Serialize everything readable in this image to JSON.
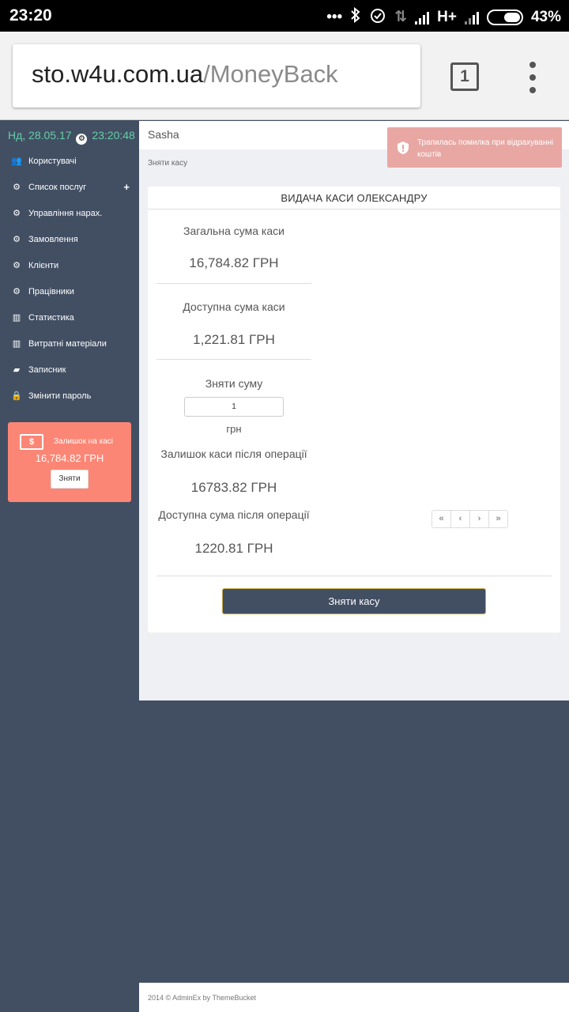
{
  "status_bar": {
    "time": "23:20",
    "network": "H+",
    "battery": "43%",
    "icons": [
      "dots-icon",
      "bluetooth-icon",
      "alarm-icon",
      "data-transfer-icon",
      "signal-icon",
      "battery-icon"
    ]
  },
  "browser": {
    "url_host": "sto.w4u.com.ua",
    "url_path": "/MoneyBack",
    "tab_count": "1"
  },
  "sidebar": {
    "date": "Нд, 28.05.17",
    "time": "23:20:48",
    "items": [
      {
        "label": "Користувачі",
        "icon": "users-icon"
      },
      {
        "label": "Список послуг",
        "icon": "cogs-icon"
      },
      {
        "label": "Управління нарах.",
        "icon": "cogs-icon"
      },
      {
        "label": "Замовлення",
        "icon": "cogs-icon"
      },
      {
        "label": "Клієнти",
        "icon": "cogs-icon"
      },
      {
        "label": "Працівники",
        "icon": "cogs-icon"
      },
      {
        "label": "Статистика",
        "icon": "bar-chart-icon"
      },
      {
        "label": "Витратні матеріали",
        "icon": "bar-chart-icon"
      },
      {
        "label": "Записник",
        "icon": "book-icon"
      },
      {
        "label": "Змінити пароль",
        "icon": "lock-icon"
      }
    ],
    "balance": {
      "label": "Залишок на касі",
      "amount": "16,784.82 ГРН",
      "button": "Зняти"
    }
  },
  "header": {
    "user": "Sasha"
  },
  "alert": {
    "text": "Трапилась помилка при відрахуванні коштів"
  },
  "breadcrumb": "Зняти касу",
  "panel": {
    "title": "ВИДАЧА КАСИ ОЛЕКСАНДРУ",
    "total_label": "Загальна сума каси",
    "total_value": "16,784.82 ГРН",
    "available_label": "Доступна сума каси",
    "available_value": "1,221.81 ГРН",
    "withdraw_label": "Зняти суму",
    "withdraw_value": "1",
    "currency": "грн",
    "remaining_label": "Залишок каси після операції",
    "remaining_value": "16783.82 ГРН",
    "available_after_label": "Доступна сума після операції",
    "available_after_value": "1220.81 ГРН",
    "submit": "Зняти касу"
  },
  "pager": [
    "«",
    "‹",
    "›",
    "»"
  ],
  "footer": "2014 © AdminEx by ThemeBucket",
  "colors": {
    "sidebar": "#424f63",
    "accent_green": "#65cea7",
    "balance_card": "#fc8675",
    "alert": "#e8a7a3",
    "content_bg": "#eff0f4"
  }
}
